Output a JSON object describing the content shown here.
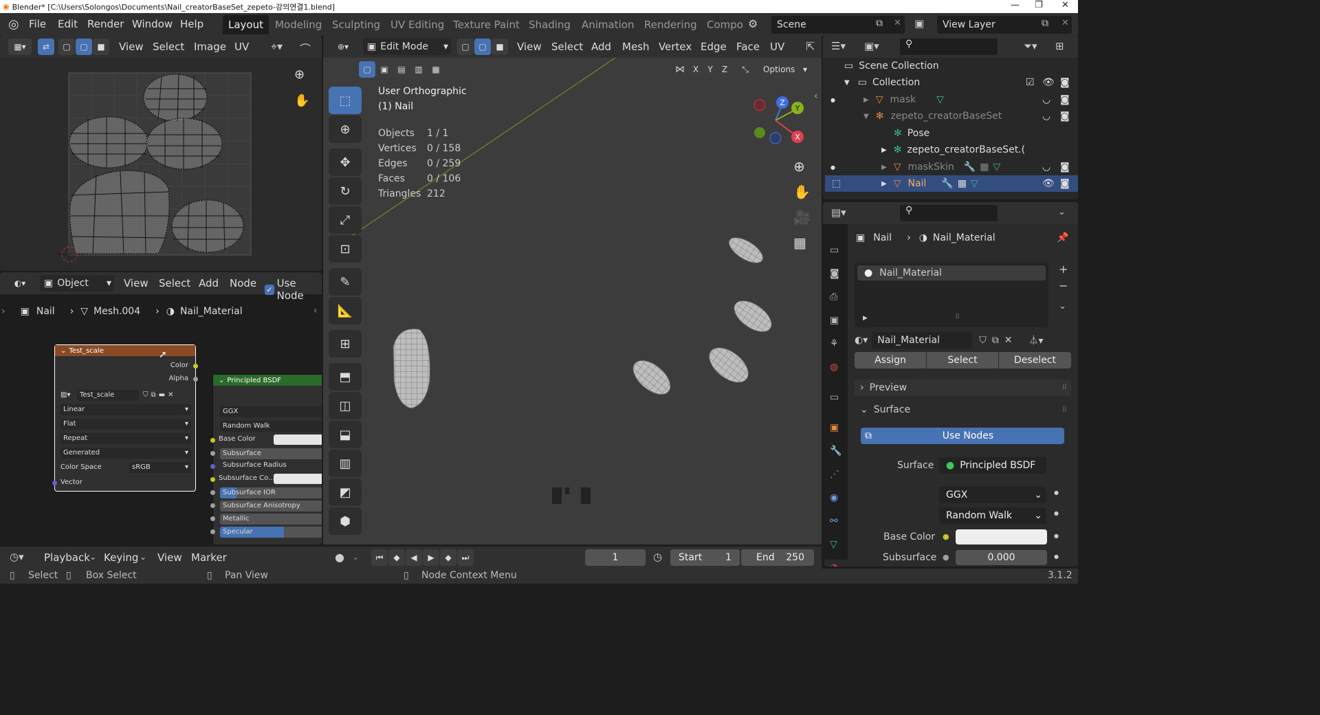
{
  "title_bar": {
    "text": "Blender* [C:\\Users\\Solongos\\Documents\\Nail_creatorBaseSet_zepeto-강의연결1.blend]"
  },
  "top_menu": {
    "menus": [
      "File",
      "Edit",
      "Render",
      "Window",
      "Help"
    ],
    "workspaces": [
      "Layout",
      "Modeling",
      "Sculpting",
      "UV Editing",
      "Texture Paint",
      "Shading",
      "Animation",
      "Rendering",
      "Compo"
    ],
    "active_workspace": "Layout",
    "scene": "Scene",
    "view_layer": "View Layer"
  },
  "uv_editor": {
    "menus": [
      "View",
      "Select",
      "Image",
      "UV"
    ]
  },
  "viewport_header": {
    "mode": "Edit Mode",
    "menus": [
      "View",
      "Select",
      "Add",
      "Mesh",
      "Vertex",
      "Edge",
      "Face",
      "UV"
    ],
    "axes": [
      "X",
      "Y",
      "Z"
    ],
    "options": "Options"
  },
  "viewport_info": {
    "view_name": "User Orthographic",
    "object_name": "(1) Nail",
    "stats": [
      {
        "label": "Objects",
        "value": "1 / 1"
      },
      {
        "label": "Vertices",
        "value": "0 / 158"
      },
      {
        "label": "Edges",
        "value": "0 / 259"
      },
      {
        "label": "Faces",
        "value": "0 / 106"
      },
      {
        "label": "Triangles",
        "value": "212"
      }
    ],
    "gizmo": {
      "z": "Z",
      "y": "Y",
      "x": "X"
    }
  },
  "node_editor": {
    "mode": "Object",
    "menus": [
      "View",
      "Select",
      "Add",
      "Node"
    ],
    "use_nodes": "Use Node",
    "breadcrumb": [
      "Nail",
      "Mesh.004",
      "Nail_Material"
    ],
    "image_node": {
      "title": "Test_scale",
      "outputs": [
        "Color",
        "Alpha"
      ],
      "image_name": "Test_scale",
      "dropdowns": [
        "Linear",
        "Flat",
        "Repeat",
        "Generated"
      ],
      "color_space_label": "Color Space",
      "color_space": "sRGB",
      "input": "Vector"
    },
    "bsdf_node": {
      "title": "Principled BSDF",
      "rows": [
        "GGX",
        "Random Walk",
        "Base Color",
        "Subsurface",
        "Subsurface Radius",
        "Subsurface Co...",
        "Subsurface IOR",
        "Subsurface Anisotropy",
        "Metallic",
        "Specular"
      ]
    }
  },
  "outliner": {
    "items": [
      {
        "label": "Scene Collection",
        "depth": 0
      },
      {
        "label": "Collection",
        "depth": 1
      },
      {
        "label": "mask",
        "depth": 2,
        "dim": true
      },
      {
        "label": "zepeto_creatorBaseSet",
        "depth": 2,
        "dim": true
      },
      {
        "label": "Pose",
        "depth": 3
      },
      {
        "label": "zepeto_creatorBaseSet.(",
        "depth": 3
      },
      {
        "label": "maskSkin",
        "depth": 2,
        "dim": true
      },
      {
        "label": "Nail",
        "depth": 2,
        "selected": true
      }
    ]
  },
  "properties": {
    "breadcrumb": [
      "Nail",
      "Nail_Material"
    ],
    "slot": "Nail_Material",
    "material_name": "Nail_Material",
    "buttons": [
      "Assign",
      "Select",
      "Deselect"
    ],
    "sections": [
      "Preview",
      "Surface"
    ],
    "use_nodes": "Use Nodes",
    "surface_label": "Surface",
    "surface_value": "Principled BSDF",
    "distribution": "GGX",
    "subsurface_method": "Random Walk",
    "base_color_label": "Base Color",
    "subsurface_label": "Subsurface",
    "subsurface_value": "0.000"
  },
  "timeline": {
    "menus": [
      "Playback",
      "Keying",
      "View",
      "Marker"
    ],
    "current_frame": "1",
    "start_label": "Start",
    "start": "1",
    "end_label": "End",
    "end": "250"
  },
  "status_bar": {
    "items": [
      "Select",
      "Box Select",
      "Pan View",
      "Node Context Menu"
    ],
    "version": "3.1.2"
  },
  "colors": {
    "accent": "#4772b3",
    "selected_row": "#334d80",
    "node_header_image": "#8a4b24",
    "node_header_shader": "#2a6a2a"
  }
}
